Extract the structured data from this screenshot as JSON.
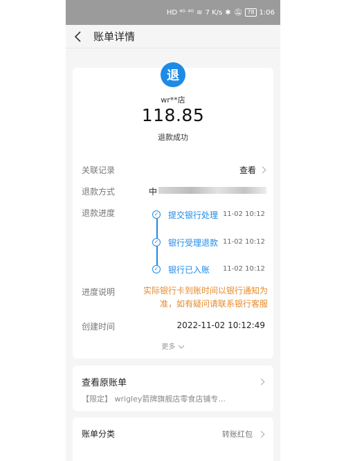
{
  "status_bar": {
    "left_icons": "HD ⁴ᴳ ⁴ᴳ",
    "speed": "7 K/s",
    "battery": "78",
    "time": "1:06"
  },
  "header": {
    "title": "账单详情",
    "back_icon": "chevron-left-icon"
  },
  "summary": {
    "badge": "退",
    "merchant": "wr**店",
    "amount": "118.85",
    "status": "退款成功"
  },
  "details": {
    "related_label": "关联记录",
    "related_value": "查看",
    "method_label": "退款方式",
    "method_value": "中",
    "progress_label": "退款进度",
    "steps": [
      {
        "label": "提交银行处理",
        "time": "11-02 10:12"
      },
      {
        "label": "银行受理退款",
        "time": "11-02 10:12"
      },
      {
        "label": "银行已入账",
        "time": "11-02 10:12"
      }
    ],
    "note_label": "进度说明",
    "note_text": "实际银行卡到账时间以银行通知为准，如有疑问请联系银行客服",
    "created_label": "创建时间",
    "created_value": "2022-11-02 10:12:49",
    "more": "更多"
  },
  "original_bill": {
    "title": "查看原账单",
    "subtitle": "【限定】 wrigley箭牌旗舰店零食店铺专..."
  },
  "category": {
    "label": "账单分类",
    "value": "转账红包"
  },
  "colors": {
    "accent": "#1e8ae6",
    "note": "#e58a2b",
    "status_bar": "#9b9b9b"
  }
}
